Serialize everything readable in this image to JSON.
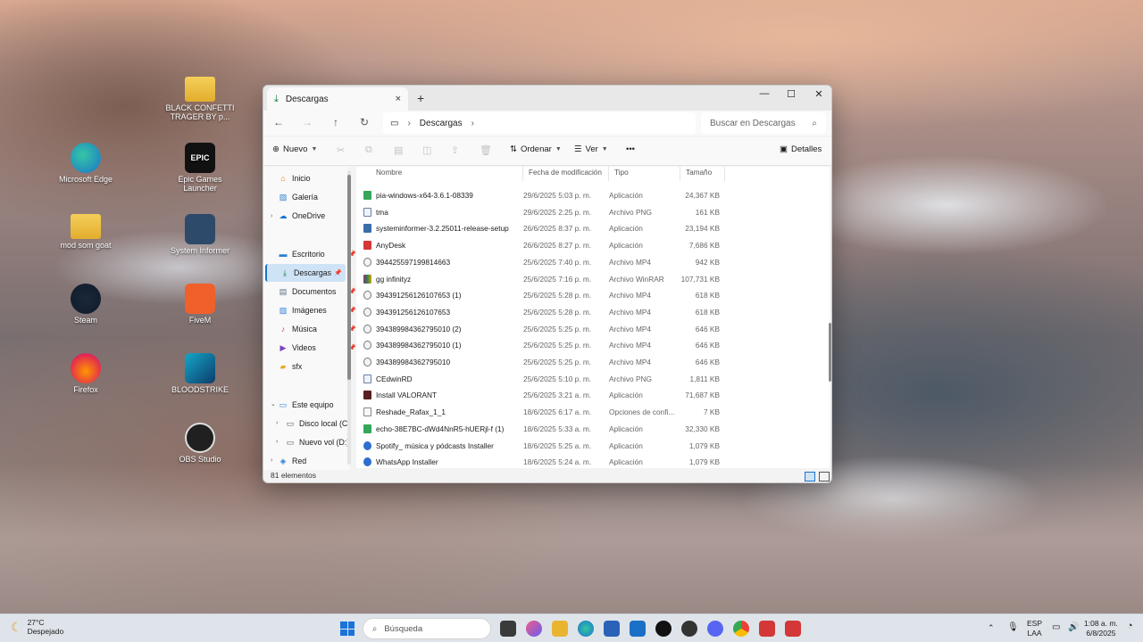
{
  "desktop": {
    "icons": [
      {
        "label": "BLACK CONFETTI TRAGER BY p...",
        "icon": "folder-icon"
      },
      {
        "label": "Microsoft Edge",
        "icon": "edge-icon"
      },
      {
        "label": "Epic Games Launcher",
        "icon": "epic-games-icon",
        "glyph": "EPIC"
      },
      {
        "label": "mod som goat",
        "icon": "folder-icon"
      },
      {
        "label": "System Informer",
        "icon": "system-informer-icon"
      },
      {
        "label": "Steam",
        "icon": "steam-icon"
      },
      {
        "label": "FiveM",
        "icon": "fivem-icon"
      },
      {
        "label": "Firefox",
        "icon": "firefox-icon"
      },
      {
        "label": "BLOODSTRIKE",
        "icon": "bloodstrike-icon"
      },
      {
        "label": "OBS Studio",
        "icon": "obs-icon"
      }
    ]
  },
  "window": {
    "tab_title": "Descargas",
    "close_tab": "×",
    "new_tab": "+",
    "controls": {
      "minimize": "—",
      "maximize": "☐",
      "close": "✕"
    },
    "address": {
      "segment": "Descargas",
      "sep": "›",
      "trail": "›"
    },
    "search_placeholder": "Buscar en Descargas",
    "toolbar": {
      "new_label": "Nuevo",
      "sort_label": "Ordenar",
      "view_label": "Ver",
      "more_label": "•••",
      "details_label": "Detalles"
    }
  },
  "sidebar": {
    "items": [
      {
        "label": "Inicio",
        "icon": "home-icon",
        "pinned": false
      },
      {
        "label": "Galería",
        "icon": "gallery-icon",
        "pinned": false
      },
      {
        "label": "OneDrive",
        "icon": "onedrive-icon",
        "pinned": false
      },
      {
        "label": "Escritorio",
        "icon": "desktop-icon",
        "pinned": true
      },
      {
        "label": "Descargas",
        "icon": "download-icon",
        "pinned": true,
        "selected": true
      },
      {
        "label": "Documentos",
        "icon": "documents-icon",
        "pinned": true
      },
      {
        "label": "Imágenes",
        "icon": "pictures-icon",
        "pinned": true
      },
      {
        "label": "Música",
        "icon": "music-icon",
        "pinned": true
      },
      {
        "label": "Videos",
        "icon": "videos-icon",
        "pinned": true
      },
      {
        "label": "sfx",
        "icon": "folder-icon",
        "pinned": false
      },
      {
        "label": "Este equipo",
        "icon": "pc-icon",
        "pinned": false
      },
      {
        "label": "Disco local (C:",
        "icon": "drive-icon",
        "pinned": false
      },
      {
        "label": "Nuevo vol (D:)",
        "icon": "drive-icon",
        "pinned": false
      },
      {
        "label": "Red",
        "icon": "network-icon",
        "pinned": false
      }
    ]
  },
  "columns": {
    "name": "Nombre",
    "date": "Fecha de modificación",
    "type": "Tipo",
    "size": "Tamaño"
  },
  "files": [
    {
      "name": "pia-windows-x64-3.6.1-08339",
      "date": "29/6/2025 5:03 p. m.",
      "type": "Aplicación",
      "size": "24,367 KB",
      "icon": "fi-green"
    },
    {
      "name": "tma",
      "date": "29/6/2025 2:25 p. m.",
      "type": "Archivo PNG",
      "size": "161 KB",
      "icon": "fi-png"
    },
    {
      "name": "systeminformer-3.2.25011-release-setup",
      "date": "26/6/2025 8:37 p. m.",
      "type": "Aplicación",
      "size": "23,194 KB",
      "icon": "fi-exe"
    },
    {
      "name": "AnyDesk",
      "date": "26/6/2025 8:27 p. m.",
      "type": "Aplicación",
      "size": "7,686 KB",
      "icon": "fi-red"
    },
    {
      "name": "394425597199814663",
      "date": "25/6/2025 7:40 p. m.",
      "type": "Archivo MP4",
      "size": "942 KB",
      "icon": "fi-mp4"
    },
    {
      "name": "gg infinityz",
      "date": "25/6/2025 7:16 p. m.",
      "type": "Archivo WinRAR",
      "size": "107,731 KB",
      "icon": "fi-rar"
    },
    {
      "name": "394391256126107653 (1)",
      "date": "25/6/2025 5:28 p. m.",
      "type": "Archivo MP4",
      "size": "618 KB",
      "icon": "fi-mp4"
    },
    {
      "name": "394391256126107653",
      "date": "25/6/2025 5:28 p. m.",
      "type": "Archivo MP4",
      "size": "618 KB",
      "icon": "fi-mp4"
    },
    {
      "name": "394389984362795010 (2)",
      "date": "25/6/2025 5:25 p. m.",
      "type": "Archivo MP4",
      "size": "646 KB",
      "icon": "fi-mp4"
    },
    {
      "name": "394389984362795010 (1)",
      "date": "25/6/2025 5:25 p. m.",
      "type": "Archivo MP4",
      "size": "646 KB",
      "icon": "fi-mp4"
    },
    {
      "name": "394389984362795010",
      "date": "25/6/2025 5:25 p. m.",
      "type": "Archivo MP4",
      "size": "646 KB",
      "icon": "fi-mp4"
    },
    {
      "name": "CEdwinRD",
      "date": "25/6/2025 5:10 p. m.",
      "type": "Archivo PNG",
      "size": "1,811 KB",
      "icon": "fi-png"
    },
    {
      "name": "Install VALORANT",
      "date": "25/6/2025 3:21 a. m.",
      "type": "Aplicación",
      "size": "71,687 KB",
      "icon": "fi-dark"
    },
    {
      "name": "Reshade_Rafax_1_1",
      "date": "18/6/2025 6:17 a. m.",
      "type": "Opciones de confi...",
      "size": "7 KB",
      "icon": "fi-cfg"
    },
    {
      "name": "echo-38E7BC-dWd4NnR5-hUERjl-f (1)",
      "date": "18/6/2025 5:33 a. m.",
      "type": "Aplicación",
      "size": "32,330 KB",
      "icon": "fi-green"
    },
    {
      "name": "Spotify_ música y pódcasts Installer",
      "date": "18/6/2025 5:25 a. m.",
      "type": "Aplicación",
      "size": "1,079 KB",
      "icon": "fi-dl"
    },
    {
      "name": "WhatsApp Installer",
      "date": "18/6/2025 5:24 a. m.",
      "type": "Aplicación",
      "size": "1,079 KB",
      "icon": "fi-dl"
    }
  ],
  "status": {
    "count": "81 elementos"
  },
  "taskbar": {
    "temperature": "27°C",
    "weather": "Despejado",
    "search_placeholder": "Búsqueda",
    "lang_top": "ESP",
    "lang_bottom": "LAA",
    "time": "1:08 a. m.",
    "date": "6/8/2025"
  }
}
